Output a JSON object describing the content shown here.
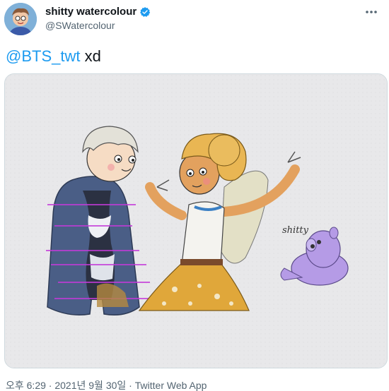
{
  "user": {
    "display_name": "shitty watercolour",
    "handle": "@SWatercolour"
  },
  "tweet": {
    "mention": "@BTS_twt",
    "text_after": " xd",
    "media": {
      "signature": "shitty"
    }
  },
  "meta": {
    "time": "오후 6:29",
    "date": "2021년 9월 30일",
    "separator": " · ",
    "app": "Twitter Web App"
  },
  "colors": {
    "accent": "#1d9bf0",
    "secondary_text": "#536471"
  }
}
